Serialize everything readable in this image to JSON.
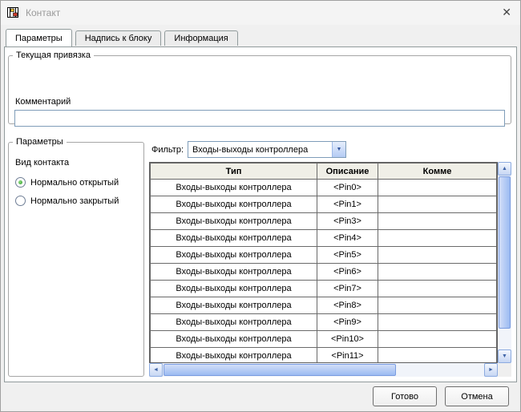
{
  "window": {
    "title": "Контакт"
  },
  "icons": {
    "close": "✕",
    "dropdown": "▼",
    "up": "▲",
    "down": "▼",
    "left": "◄",
    "right": "►"
  },
  "tabs": [
    {
      "label": "Параметры",
      "active": true
    },
    {
      "label": "Надпись к блоку",
      "active": false
    },
    {
      "label": "Информация",
      "active": false
    }
  ],
  "binding_group": {
    "title": "Текущая привязка",
    "comment_label": "Комментарий",
    "comment_value": ""
  },
  "params_group": {
    "title": "Параметры",
    "kind_label": "Вид контакта",
    "options": [
      {
        "label": "Нормально открытый",
        "selected": true
      },
      {
        "label": "Нормально закрытый",
        "selected": false
      }
    ]
  },
  "filter": {
    "label": "Фильтр:",
    "value": "Входы-выходы контроллера"
  },
  "table": {
    "columns": [
      "Тип",
      "Описание",
      "Комме"
    ],
    "rows": [
      {
        "type": "Входы-выходы контроллера",
        "desc": "<Pin0>",
        "comment": ""
      },
      {
        "type": "Входы-выходы контроллера",
        "desc": "<Pin1>",
        "comment": ""
      },
      {
        "type": "Входы-выходы контроллера",
        "desc": "<Pin3>",
        "comment": ""
      },
      {
        "type": "Входы-выходы контроллера",
        "desc": "<Pin4>",
        "comment": ""
      },
      {
        "type": "Входы-выходы контроллера",
        "desc": "<Pin5>",
        "comment": ""
      },
      {
        "type": "Входы-выходы контроллера",
        "desc": "<Pin6>",
        "comment": ""
      },
      {
        "type": "Входы-выходы контроллера",
        "desc": "<Pin7>",
        "comment": ""
      },
      {
        "type": "Входы-выходы контроллера",
        "desc": "<Pin8>",
        "comment": ""
      },
      {
        "type": "Входы-выходы контроллера",
        "desc": "<Pin9>",
        "comment": ""
      },
      {
        "type": "Входы-выходы контроллера",
        "desc": "<Pin10>",
        "comment": ""
      },
      {
        "type": "Входы-выходы контроллера",
        "desc": "<Pin11>",
        "comment": ""
      }
    ]
  },
  "buttons": {
    "done": "Готово",
    "cancel": "Отмена"
  }
}
